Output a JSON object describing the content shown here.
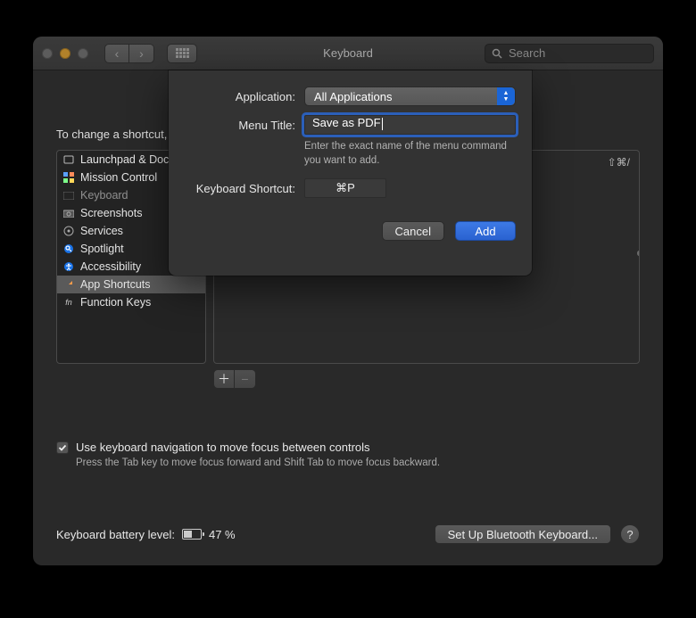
{
  "window": {
    "title": "Keyboard",
    "search_placeholder": "Search"
  },
  "note_text": "To change a shortcut, select it, click the key combination, and then type the new keys.",
  "sidebar": {
    "items": [
      {
        "label": "Launchpad & Dock",
        "icon": "launchpad-icon",
        "selected": false
      },
      {
        "label": "Mission Control",
        "icon": "mission-control-icon",
        "selected": false
      },
      {
        "label": "Keyboard",
        "icon": "keyboard-icon",
        "selected": false,
        "disabled": true
      },
      {
        "label": "Screenshots",
        "icon": "screenshots-icon",
        "selected": false
      },
      {
        "label": "Services",
        "icon": "services-icon",
        "selected": false
      },
      {
        "label": "Spotlight",
        "icon": "spotlight-icon",
        "selected": false
      },
      {
        "label": "Accessibility",
        "icon": "accessibility-icon",
        "selected": false
      },
      {
        "label": "App Shortcuts",
        "icon": "app-shortcuts-icon",
        "selected": true
      },
      {
        "label": "Function Keys",
        "icon": "function-keys-icon",
        "selected": false
      }
    ]
  },
  "right_pane": {
    "row_shortcut": "⇧⌘/"
  },
  "checkbox": {
    "checked": true,
    "label": "Use keyboard navigation to move focus between controls",
    "hint": "Press the Tab key to move focus forward and Shift Tab to move focus backward."
  },
  "footer": {
    "battery_label": "Keyboard battery level:",
    "battery_value": "47 %",
    "bluetooth_btn": "Set Up Bluetooth Keyboard..."
  },
  "sheet": {
    "app_label": "Application:",
    "app_value": "All Applications",
    "menu_title_label": "Menu Title:",
    "menu_title_value": "Save as PDF",
    "menu_title_hint": "Enter the exact name of the menu command you want to add.",
    "shortcut_label": "Keyboard Shortcut:",
    "shortcut_value": "⌘P",
    "cancel": "Cancel",
    "add": "Add"
  }
}
